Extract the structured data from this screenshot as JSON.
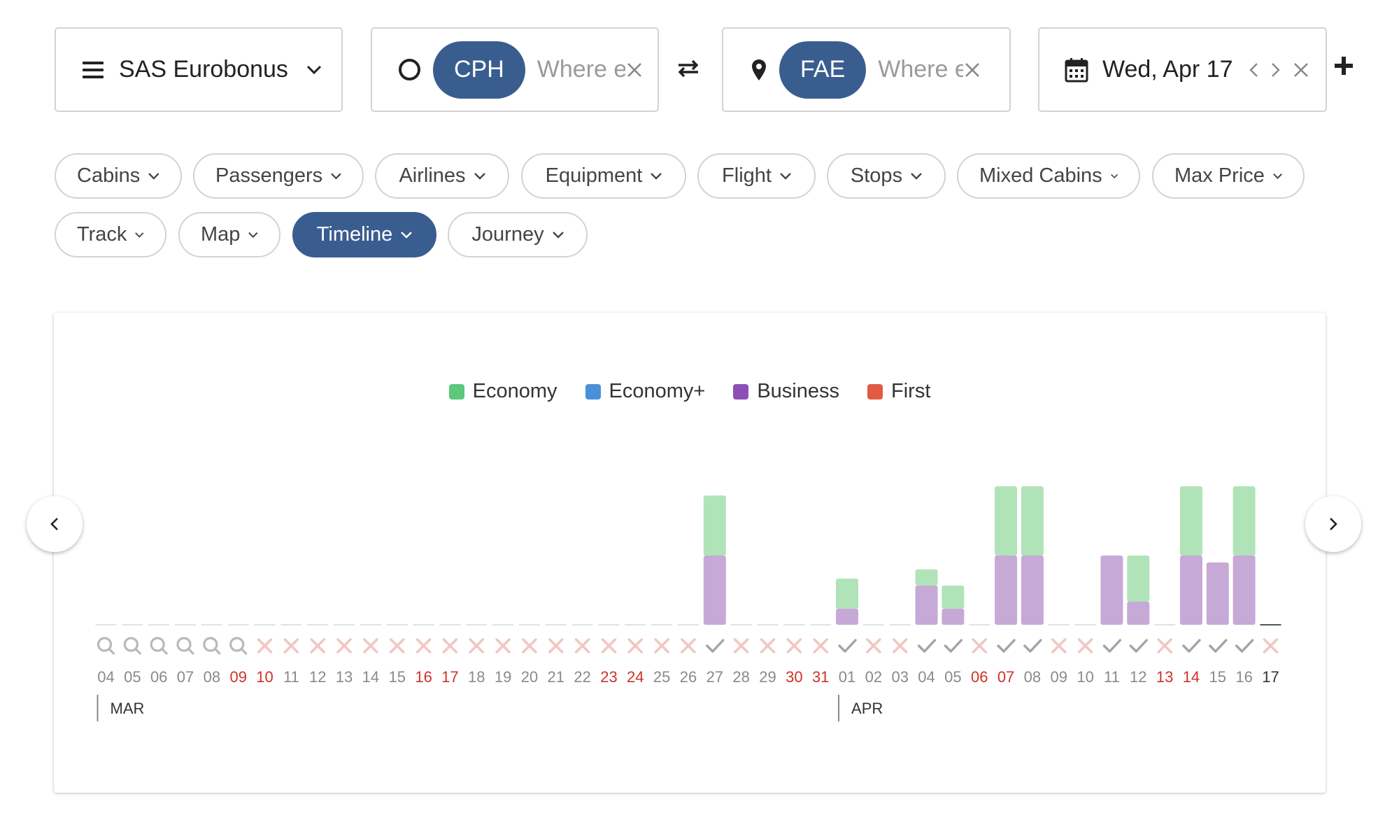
{
  "header": {
    "program": "SAS Eurobonus",
    "origin": {
      "code": "CPH",
      "placeholder": "Where else?"
    },
    "destination": {
      "code": "FAE",
      "placeholder": "Where else?"
    },
    "date": "Wed, Apr 17"
  },
  "filters": {
    "row1": [
      "Cabins",
      "Passengers",
      "Airlines",
      "Equipment",
      "Flight",
      "Stops",
      "Mixed Cabins",
      "Max Price"
    ],
    "row2": [
      "Track",
      "Map",
      "Timeline",
      "Journey"
    ],
    "active": "Timeline"
  },
  "colors": {
    "accent": "#3a5d8f",
    "economy": "#5dc77a",
    "economy_plus": "#4a90d9",
    "business": "#8d4fb5",
    "first": "#e05a44",
    "economy_bar": "#b1e3b9",
    "business_bar": "#c7a9d8",
    "weekend_red": "#cc3328"
  },
  "legend": [
    {
      "label": "Economy",
      "color": "#5dc77a"
    },
    {
      "label": "Economy+",
      "color": "#4a90d9"
    },
    {
      "label": "Business",
      "color": "#8d4fb5"
    },
    {
      "label": "First",
      "color": "#e05a44"
    }
  ],
  "chart_data": {
    "type": "bar",
    "stacked": true,
    "categories": [
      "04",
      "05",
      "06",
      "07",
      "08",
      "09",
      "10",
      "11",
      "12",
      "13",
      "14",
      "15",
      "16",
      "17",
      "18",
      "19",
      "20",
      "21",
      "22",
      "23",
      "24",
      "25",
      "26",
      "27",
      "28",
      "29",
      "30",
      "31",
      "01",
      "02",
      "03",
      "04",
      "05",
      "06",
      "07",
      "08",
      "09",
      "10",
      "11",
      "12",
      "13",
      "14",
      "15",
      "16",
      "17"
    ],
    "series": [
      {
        "name": "Business",
        "values": [
          0,
          0,
          0,
          0,
          0,
          0,
          0,
          0,
          0,
          0,
          0,
          0,
          0,
          0,
          0,
          0,
          0,
          0,
          0,
          0,
          0,
          0,
          0,
          3,
          0,
          0,
          0,
          0,
          0.7,
          0,
          0,
          1.7,
          0.7,
          0,
          3,
          3,
          0,
          0,
          3,
          1,
          0,
          3,
          2.7,
          3,
          0
        ]
      },
      {
        "name": "Economy",
        "values": [
          0,
          0,
          0,
          0,
          0,
          0,
          0,
          0,
          0,
          0,
          0,
          0,
          0,
          0,
          0,
          0,
          0,
          0,
          0,
          0,
          0,
          0,
          0,
          2.6,
          0,
          0,
          0,
          0,
          1.3,
          0,
          0,
          0.7,
          1,
          0,
          3,
          3,
          0,
          0,
          0,
          2,
          0,
          3,
          0,
          3,
          0
        ]
      }
    ],
    "status": [
      "search",
      "search",
      "search",
      "search",
      "search",
      "search",
      "none",
      "none",
      "none",
      "none",
      "none",
      "none",
      "none",
      "none",
      "none",
      "none",
      "none",
      "none",
      "none",
      "none",
      "none",
      "none",
      "none",
      "check",
      "none",
      "none",
      "none",
      "none",
      "check",
      "none",
      "none",
      "check",
      "check",
      "none",
      "check",
      "check",
      "none",
      "none",
      "check",
      "check",
      "none",
      "check",
      "check",
      "check",
      "none"
    ],
    "weekend": [
      false,
      false,
      false,
      false,
      false,
      true,
      true,
      false,
      false,
      false,
      false,
      false,
      true,
      true,
      false,
      false,
      false,
      false,
      false,
      true,
      true,
      false,
      false,
      false,
      false,
      false,
      true,
      true,
      false,
      false,
      false,
      false,
      false,
      true,
      true,
      false,
      false,
      false,
      false,
      false,
      true,
      true,
      false,
      false,
      false
    ],
    "current_index": 44,
    "months": [
      {
        "label": "MAR",
        "start_index": 0
      },
      {
        "label": "APR",
        "start_index": 28
      }
    ]
  }
}
